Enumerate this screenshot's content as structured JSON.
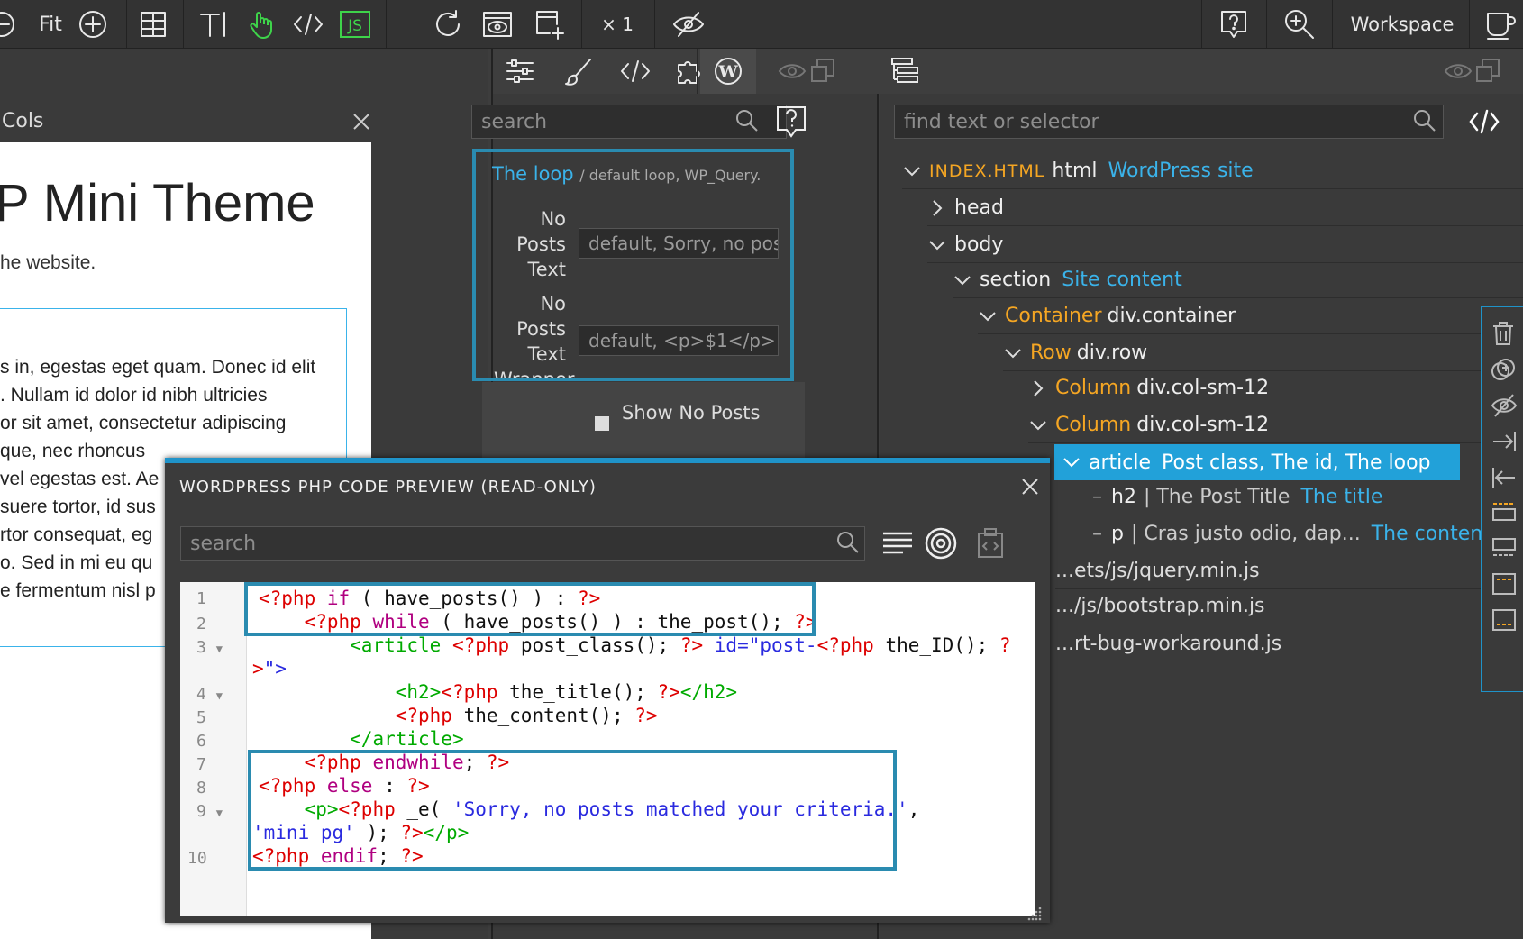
{
  "toolbar": {
    "fit_label": "Fit",
    "zoom_label": "× 1",
    "workspace_label": "Workspace"
  },
  "page": {
    "cols_label": "Cols",
    "heading": "P Mini Theme",
    "subtext": "he website.",
    "lines": [
      "s in, egestas eget quam. Donec id elit",
      ". Nullam id dolor id nibh ultricies",
      "or sit amet, consectetur adipiscing",
      "que, nec rhoncus",
      "vel egestas est. Ae",
      "suere tortor, id sus",
      "rtor consequat, eg",
      "o. Sed in mi eu qu",
      "e fermentum nisl p"
    ]
  },
  "mid": {
    "search_placeholder": "search",
    "loop_title": "The loop",
    "loop_sub": "/ default loop, WP_Query.",
    "field1_label_a": "No",
    "field1_label_b": "Posts",
    "field1_label_c": "Text",
    "field1_value": "default, Sorry, no posts",
    "field2_label_a": "No",
    "field2_label_b": "Posts",
    "field2_label_c": "Text",
    "field2_label_d": "Wrapper",
    "field2_value": "default, <p>$1</p>",
    "show_no_posts": "Show No Posts"
  },
  "tree": {
    "search_placeholder": "find text or selector",
    "r0_tag": "INDEX.HTML",
    "r0_el": "html",
    "r0_name": "WordPress site",
    "r1_el": "head",
    "r2_el": "body",
    "r3_el": "section",
    "r3_name": "Site content",
    "r4_tag": "Container",
    "r4_el": "div.container",
    "r5_tag": "Row",
    "r5_el": "div.row",
    "r6_tag": "Column",
    "r6_el": "div.col-sm-12",
    "r7_tag": "Column",
    "r7_el": "div.col-sm-12",
    "r8_el": "article",
    "r8_name": "Post class, The id, The loop",
    "r9_el": "h2",
    "r9_text": "| The Post Title",
    "r9_name": "The title",
    "r10_el": "p",
    "r10_text": "| Cras justo odio, dap...",
    "r10_name": "The content",
    "r11": "...ets/js/jquery.min.js",
    "r12": ".../js/bootstrap.min.js",
    "r13": "...rt-bug-workaround.js"
  },
  "modal": {
    "title": "WORDPRESS PHP CODE PREVIEW (READ-ONLY)",
    "search_placeholder": "search",
    "line_numbers": [
      "1",
      "2",
      "3",
      "4",
      "5",
      "6",
      "7",
      "8",
      "9",
      "10"
    ],
    "line1": [
      "<?php",
      " if",
      " ( have_posts() ) : ",
      "?>"
    ],
    "line2": [
      "    ",
      "<?php",
      " while",
      " ( have_posts() ) : the_post(); ",
      "?>"
    ],
    "line3": [
      "        ",
      "<article",
      " ",
      "<?php",
      " post_class(); ",
      "?>",
      " id=",
      "\"post-",
      "<?php",
      " the_ID(); ",
      "?"
    ],
    "line3b": [
      ">",
      "\">"
    ],
    "line4": [
      "            ",
      "<h2>",
      "<?php",
      " the_title(); ",
      "?>",
      "</h2>"
    ],
    "line5": [
      "            ",
      "<?php",
      " the_content(); ",
      "?>"
    ],
    "line6": [
      "        ",
      "</article>"
    ],
    "line7": [
      "    ",
      "<?php",
      " endwhile",
      "; ",
      "?>"
    ],
    "line8": [
      "<?php",
      " else",
      " : ",
      "?>"
    ],
    "line9": [
      "    ",
      "<p>",
      "<?php",
      " _e( ",
      "'Sorry, no posts matched your criteria.'",
      ","
    ],
    "line9b": [
      "'mini_pg'",
      " ); ",
      "?>",
      "</p>"
    ],
    "line10": [
      "<?php",
      " endif",
      "; ",
      "?>"
    ]
  }
}
